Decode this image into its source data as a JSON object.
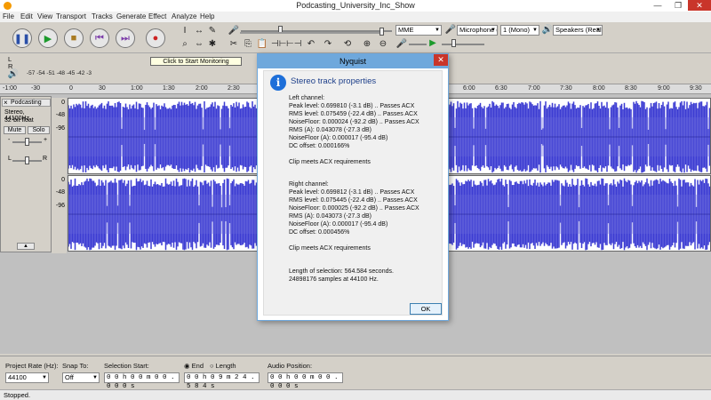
{
  "window": {
    "title": "Podcasting_University_Inc_Show",
    "controls": [
      "—",
      "❐",
      "✕"
    ]
  },
  "menu": [
    "File",
    "Edit",
    "View",
    "Transport",
    "Tracks",
    "Generate",
    "Effect",
    "Analyze",
    "Help"
  ],
  "toolbar": {
    "transport": [
      "pause",
      "play",
      "stop",
      "skip-start",
      "skip-end",
      "record"
    ],
    "host": "MME",
    "recording_device": "Microphone (U",
    "channels": "1 (Mono)",
    "playback_device": "Speakers (Realt"
  },
  "meter": {
    "tooltip": "Click to Start Monitoring",
    "scale": "-57 -54 -51 -48 -45 -42 -3",
    "scale_left_channel": "L",
    "scale_right_channel": "R"
  },
  "ruler": {
    "ticks": [
      "-1:00",
      "-30",
      "0",
      "30",
      "1:00",
      "1:30",
      "2:00",
      "2:30",
      "6:00",
      "6:30",
      "7:00",
      "7:30",
      "8:00",
      "8:30",
      "9:00",
      "9:30"
    ]
  },
  "track": {
    "name": "Podcasting",
    "format_line1": "Stereo, 44100Hz",
    "format_line2": "32-bit float",
    "mute_label": "Mute",
    "solo_label": "Solo",
    "gain_minus": "-",
    "gain_plus": "+",
    "pan_left": "L",
    "pan_right": "R",
    "scale_top": [
      "0",
      "-48",
      "-96"
    ],
    "scale_bottom": [
      "0",
      "-48",
      "-96"
    ]
  },
  "dialog": {
    "title": "Nyquist",
    "heading": "Stereo track properties",
    "left_header": "Left channel:",
    "left_lines": [
      "Peak level: 0.699810 (-3.1 dB)  .. Passes ACX",
      "RMS level: 0.075459 (-22.4 dB)  .. Passes ACX",
      "NoiseFloor: 0.000024 (-92.2 dB)  .. Passes ACX",
      "RMS (A): 0.043078 (-27.3 dB)",
      "NoiseFloor (A): 0.000017 (-95.4 dB)",
      "DC offset: 0.000166%"
    ],
    "left_verdict": "Clip meets ACX requirements",
    "right_header": "Right channel:",
    "right_lines": [
      "Peak level: 0.699812 (-3.1 dB)  .. Passes ACX",
      "RMS level: 0.075445 (-22.4 dB)  .. Passes ACX",
      "NoiseFloor: 0.000025 (-92.2 dB)  .. Passes ACX",
      "RMS (A): 0.043073 (-27.3 dB)",
      "NoiseFloor (A): 0.000017 (-95.4 dB)",
      "DC offset: 0.000456%"
    ],
    "right_verdict": "Clip meets ACX requirements",
    "length_line1": "Length of selection: 564.584 seconds.",
    "length_line2": "24898176 samples at 44100 Hz.",
    "ok_label": "OK"
  },
  "bottom": {
    "project_rate_label": "Project Rate (Hz):",
    "project_rate_value": "44100",
    "snap_label": "Snap To:",
    "snap_value": "Off",
    "selection_start_label": "Selection Start:",
    "selection_start_value": "0 0 h 0 0 m 0 0 . 0 0 0 s",
    "end_label": "End",
    "length_label": "Length",
    "selection_end_value": "0 0 h 0 9 m 2 4 . 5 8 4 s",
    "audio_position_label": "Audio Position:",
    "audio_position_value": "0 0 h 0 0 m 0 0 . 0 0 0 s"
  },
  "status": "Stopped.",
  "colors": {
    "waveform": "#3c3cd2",
    "waveform_rms": "#6464dc",
    "dialog_accent": "#6fa8dc",
    "record": "#cc2222"
  }
}
